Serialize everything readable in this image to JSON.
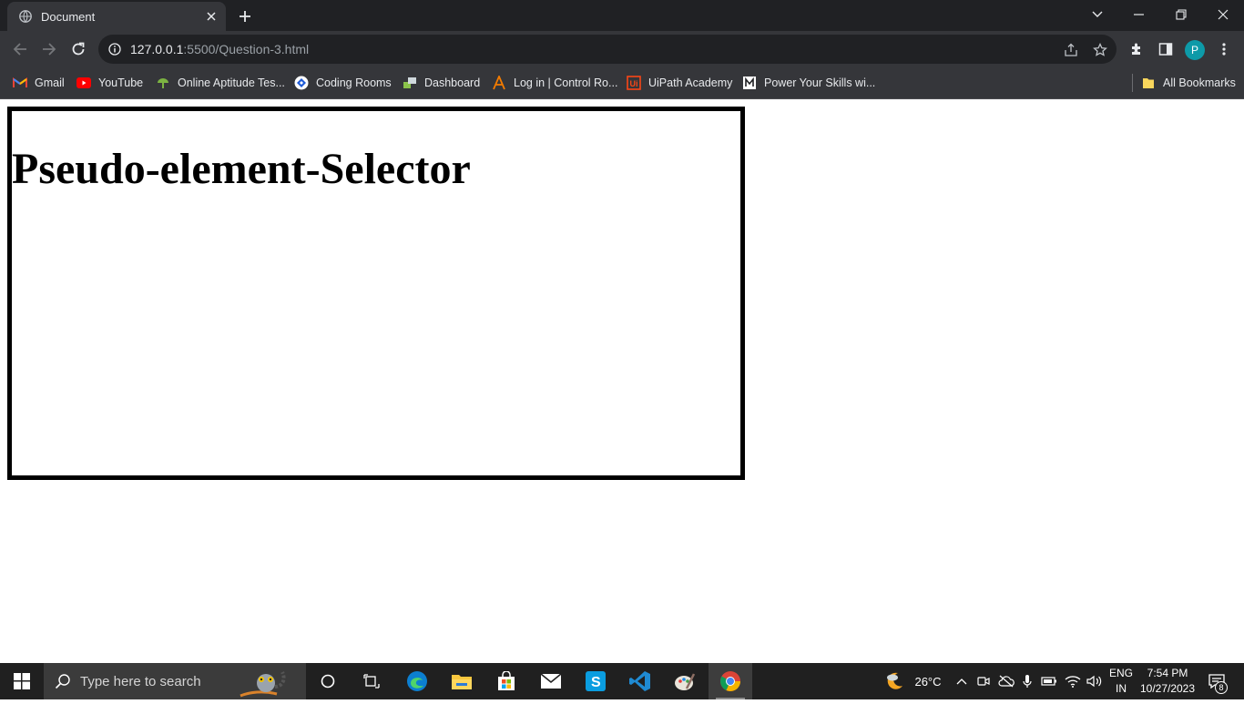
{
  "browser": {
    "tab": {
      "title": "Document"
    },
    "address": {
      "host": "127.0.0.1",
      "path": ":5500/Question-3.html"
    },
    "profile_initial": "P",
    "bookmarks": [
      {
        "label": "Gmail",
        "icon": "gmail-icon"
      },
      {
        "label": "YouTube",
        "icon": "youtube-icon"
      },
      {
        "label": "Online Aptitude Tes...",
        "icon": "aptitude-icon"
      },
      {
        "label": "Coding Rooms",
        "icon": "coding-rooms-icon"
      },
      {
        "label": "Dashboard",
        "icon": "dashboard-icon"
      },
      {
        "label": "Log in | Control Ro...",
        "icon": "control-room-icon"
      },
      {
        "label": "UiPath Academy",
        "icon": "uipath-icon"
      },
      {
        "label": "Power Your Skills wi...",
        "icon": "skills-icon"
      }
    ],
    "all_bookmarks": "All Bookmarks"
  },
  "page": {
    "heading": "Pseudo-element-Selector"
  },
  "taskbar": {
    "search_placeholder": "Type here to search",
    "weather": "26°C",
    "language": {
      "line1": "ENG",
      "line2": "IN"
    },
    "clock": {
      "time": "7:54 PM",
      "date": "10/27/2023"
    },
    "notifications": "8"
  },
  "colors": {
    "chrome_dark": "#202124",
    "chrome_toolbar": "#35363a",
    "profile": "#0d9aa8",
    "taskbar": "#202020"
  }
}
